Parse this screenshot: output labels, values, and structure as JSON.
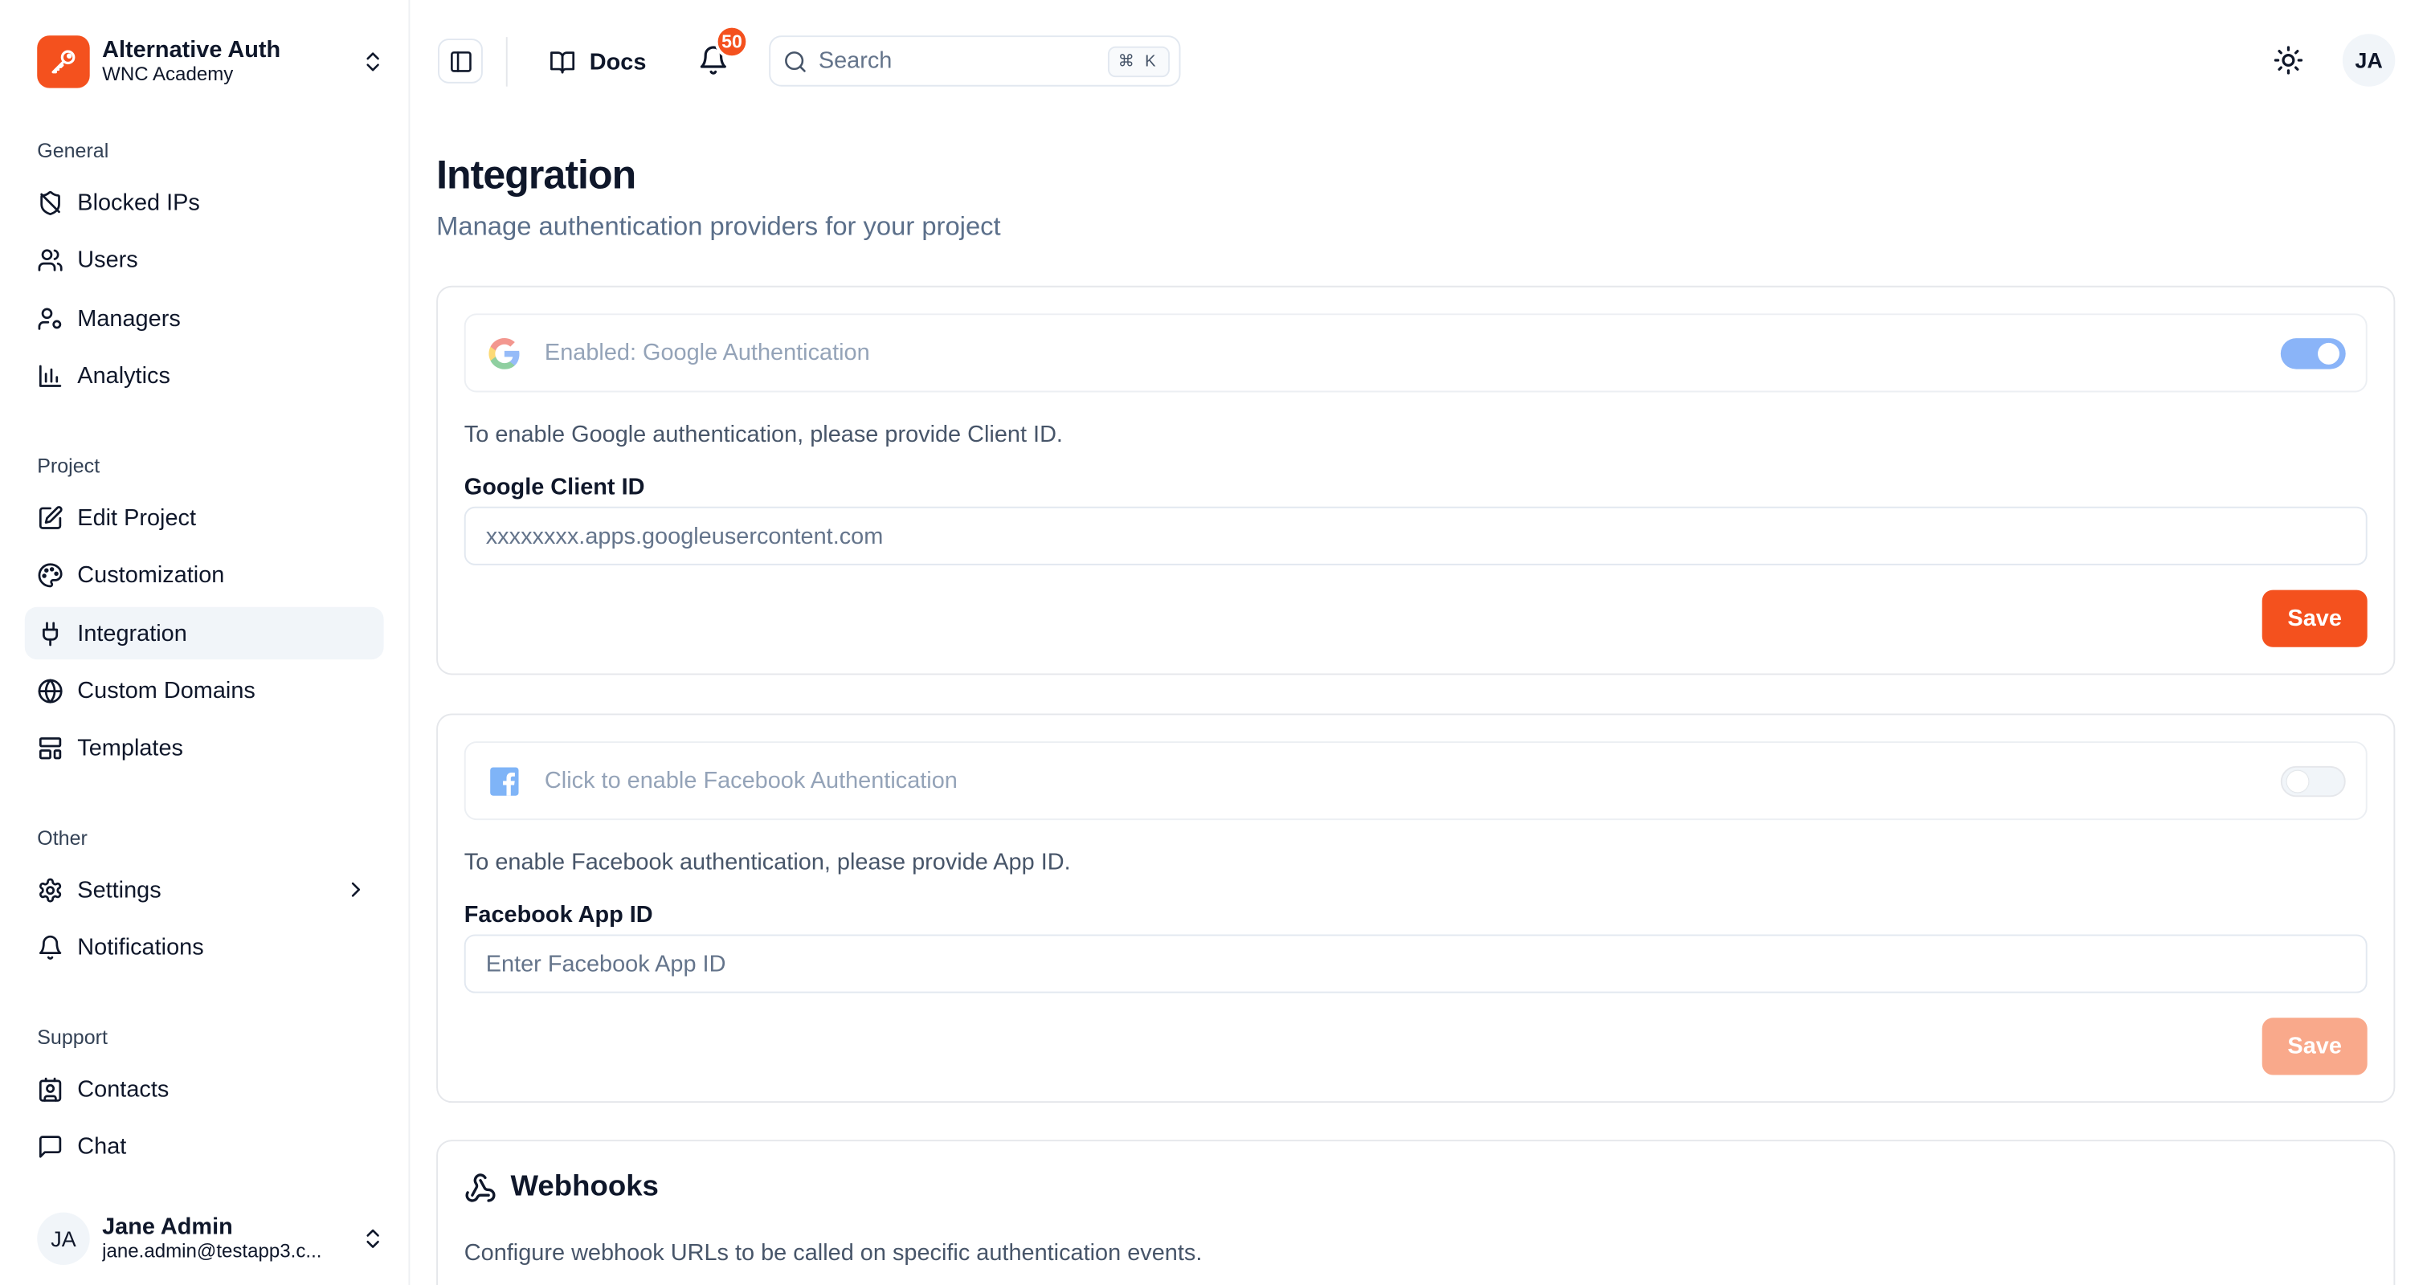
{
  "brand": {
    "title": "Alternative Auth",
    "subtitle": "WNC Academy"
  },
  "sidebar": {
    "groups": [
      {
        "label": "General",
        "items": [
          {
            "label": "Blocked IPs",
            "icon": "shield-off-icon"
          },
          {
            "label": "Users",
            "icon": "users-icon"
          },
          {
            "label": "Managers",
            "icon": "user-cog-icon"
          },
          {
            "label": "Analytics",
            "icon": "bar-chart-icon"
          }
        ]
      },
      {
        "label": "Project",
        "items": [
          {
            "label": "Edit Project",
            "icon": "edit-icon"
          },
          {
            "label": "Customization",
            "icon": "palette-icon"
          },
          {
            "label": "Integration",
            "icon": "plug-icon",
            "active": true
          },
          {
            "label": "Custom Domains",
            "icon": "globe-icon"
          },
          {
            "label": "Templates",
            "icon": "layout-template-icon"
          }
        ]
      },
      {
        "label": "Other",
        "items": [
          {
            "label": "Settings",
            "icon": "gear-icon"
          },
          {
            "label": "Notifications",
            "icon": "bell-icon"
          }
        ]
      },
      {
        "label": "Support",
        "items": [
          {
            "label": "Contacts",
            "icon": "contact-icon"
          },
          {
            "label": "Chat",
            "icon": "chat-icon"
          }
        ]
      }
    ]
  },
  "user": {
    "initials": "JA",
    "name": "Jane Admin",
    "email": "jane.admin@testapp3.c..."
  },
  "topbar": {
    "docs_label": "Docs",
    "notification_count": "50",
    "search_placeholder": "Search",
    "search_shortcut": "⌘ K",
    "avatar_initials": "JA"
  },
  "page": {
    "title": "Integration",
    "subtitle": "Manage authentication providers for your project"
  },
  "google": {
    "toggle_label": "Enabled: Google Authentication",
    "enabled": true,
    "help": "To enable Google authentication, please provide Client ID.",
    "field_label": "Google Client ID",
    "field_placeholder": "xxxxxxxx.apps.googleusercontent.com",
    "field_value": "",
    "save_label": "Save"
  },
  "facebook": {
    "toggle_label": "Click to enable Facebook Authentication",
    "enabled": false,
    "help": "To enable Facebook authentication, please provide App ID.",
    "field_label": "Facebook App ID",
    "field_placeholder": "Enter Facebook App ID",
    "field_value": "",
    "save_label": "Save"
  },
  "webhooks": {
    "title": "Webhooks",
    "description": "Configure webhook URLs to be called on specific authentication events."
  },
  "colors": {
    "accent": "#f4511e",
    "toggle_on": "#8ab4f8",
    "muted_text": "#5b6f8a"
  }
}
